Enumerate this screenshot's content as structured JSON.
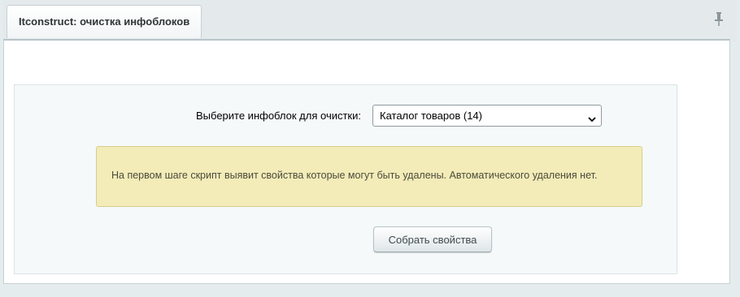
{
  "tab": {
    "title": "Itconstruct: очистка инфоблоков"
  },
  "icons": {
    "pin": "pin-icon",
    "dropdown": "chevron-down-icon"
  },
  "form": {
    "iblock_label": "Выберите инфоблок для очистки:",
    "iblock_selected": "Каталог товаров (14)"
  },
  "notice": {
    "text": "На первом шаге скрипт выявит свойства которые могут быть удалены. Автоматического удаления нет."
  },
  "actions": {
    "collect_label": "Собрать свойства"
  },
  "colors": {
    "background": "#e5ecee",
    "notice_bg": "#f3ecb9",
    "notice_border": "#d6cd8d"
  }
}
